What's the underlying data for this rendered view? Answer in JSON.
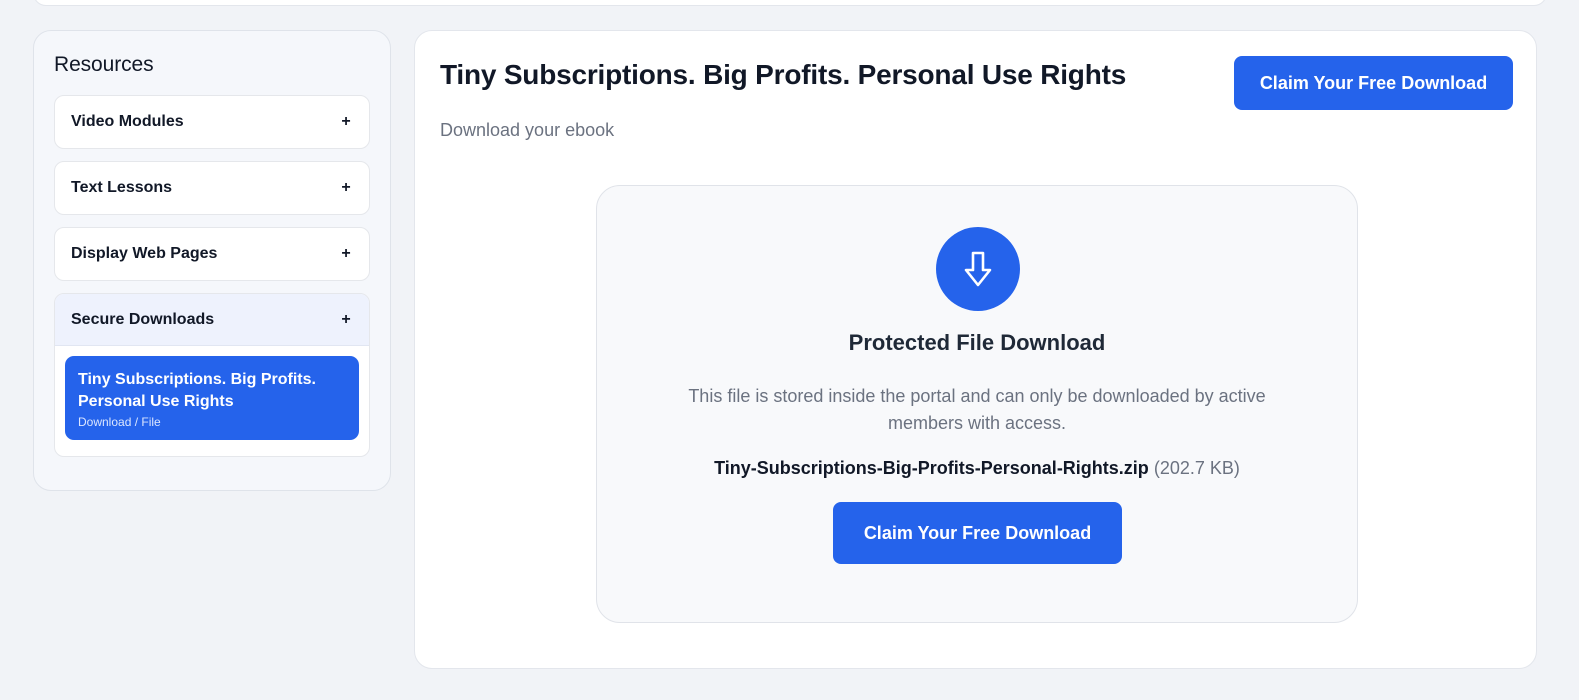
{
  "sidebar": {
    "title": "Resources",
    "sections": [
      {
        "label": "Video Modules",
        "toggle": "+"
      },
      {
        "label": "Text Lessons",
        "toggle": "+"
      },
      {
        "label": "Display Web Pages",
        "toggle": "+"
      },
      {
        "label": "Secure Downloads",
        "toggle": "+"
      }
    ],
    "active_item": {
      "title": "Tiny Subscriptions. Big Profits. Personal Use Rights",
      "subtitle": "Download / File"
    }
  },
  "main": {
    "title": "Tiny Subscriptions. Big Profits. Personal Use Rights",
    "subtitle": "Download your ebook",
    "claim_button_label": "Claim Your Free Download"
  },
  "card": {
    "icon": "download-arrow-icon",
    "title": "Protected File Download",
    "description": "This file is stored inside the portal and can only be downloaded by active members with access.",
    "file_name": "Tiny-Subscriptions-Big-Profits-Personal-Rights.zip",
    "file_size": "(202.7 KB)",
    "button_label": "Claim Your Free Download"
  },
  "colors": {
    "accent": "#2563eb",
    "background": "#f1f3f7"
  }
}
